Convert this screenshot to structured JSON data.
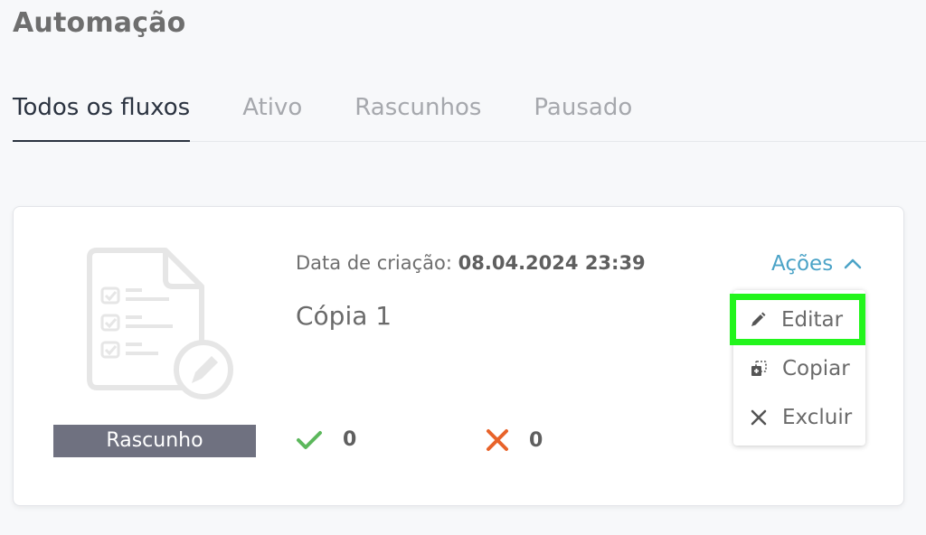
{
  "page": {
    "title": "Automação"
  },
  "tabs": [
    {
      "label": "Todos os fluxos",
      "active": true
    },
    {
      "label": "Ativo",
      "active": false
    },
    {
      "label": "Rascunhos",
      "active": false
    },
    {
      "label": "Pausado",
      "active": false
    }
  ],
  "flow_card": {
    "illustration_icon": "checklist-document-edit-icon",
    "status": "Rascunho",
    "created_label": "Data de criação:",
    "created_value": "08.04.2024 23:39",
    "name": "Cópia 1",
    "success_count": "0",
    "failure_count": "0",
    "success_icon": "check-icon",
    "failure_icon": "cross-icon",
    "actions": {
      "label": "Ações",
      "icon": "chevron-up-icon",
      "menu": [
        {
          "label": "Editar",
          "icon": "pencil-icon",
          "highlighted": true
        },
        {
          "label": "Copiar",
          "icon": "copy-icon"
        },
        {
          "label": "Excluir",
          "icon": "close-icon"
        }
      ]
    }
  },
  "colors": {
    "background": "#f7f8fa",
    "active_tab": "#2b3340",
    "inactive_tab": "#a6a8ad",
    "accent_link": "#4ba3c7",
    "status_badge": "#6f7180",
    "success": "#5cb85c",
    "failure": "#e8632a",
    "highlight": "#22f51c"
  }
}
